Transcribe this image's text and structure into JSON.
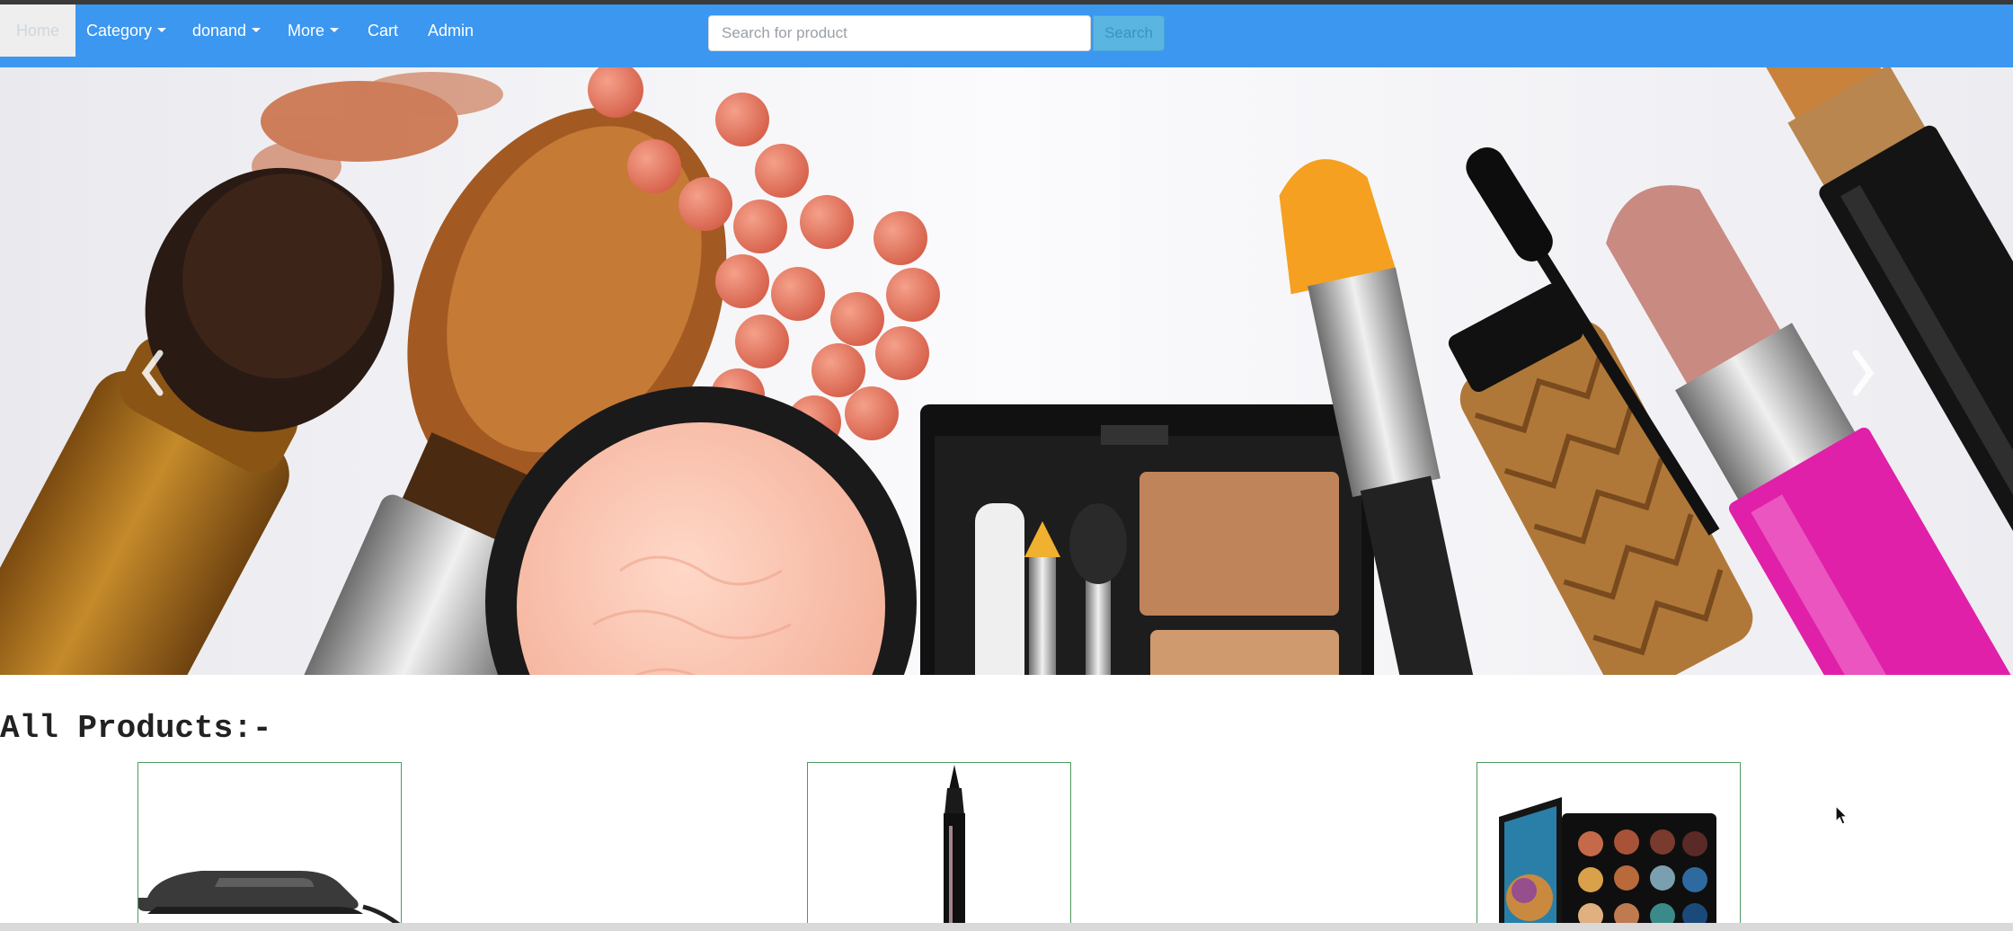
{
  "navbar": {
    "items": [
      {
        "label": "Home",
        "active": true
      },
      {
        "label": "Category",
        "has_dropdown": true
      },
      {
        "label": "donand",
        "has_dropdown": true
      },
      {
        "label": "More",
        "has_dropdown": true
      },
      {
        "label": "Cart"
      },
      {
        "label": "Admin"
      }
    ],
    "search": {
      "placeholder": "Search for product",
      "value": "",
      "button_label": "Search"
    },
    "color": "#3b97f0"
  },
  "hero": {
    "image": "makeup-banner",
    "prev_icon": "chevron-left-icon",
    "next_icon": "chevron-right-icon"
  },
  "products": {
    "heading": "All Products:-",
    "items": [
      {
        "image": "hair-straightener"
      },
      {
        "image": "eyeliner-pen"
      },
      {
        "image": "eyeshadow-palette"
      }
    ]
  }
}
